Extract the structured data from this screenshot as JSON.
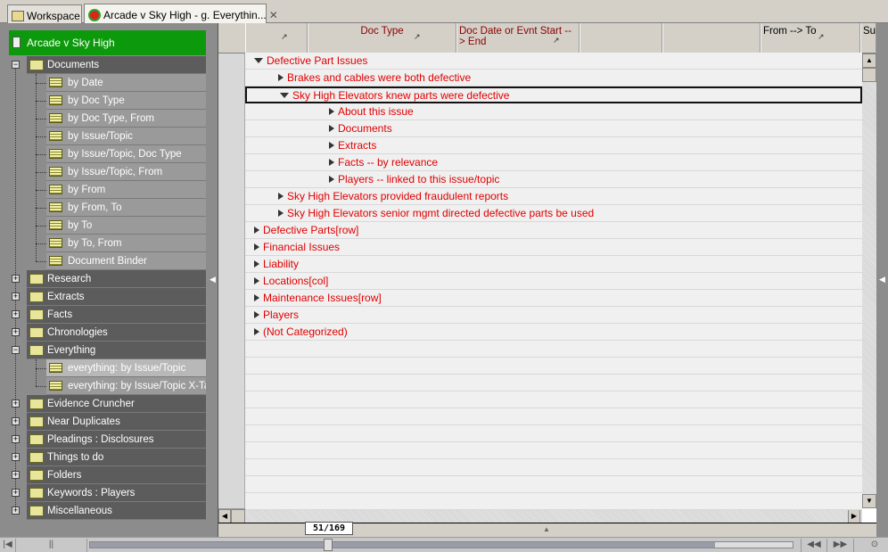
{
  "tabs": [
    {
      "label": "Workspace",
      "icon": "workspace-folder-icon"
    },
    {
      "label": "Arcade v Sky High - g. Everythin...",
      "icon": "case-icon",
      "close": "✕"
    }
  ],
  "tree": {
    "root": "Arcade v Sky High",
    "documents": {
      "label": "Documents",
      "children": [
        "by Date",
        "by Doc Type",
        "by Doc Type, From",
        "by Issue/Topic",
        "by Issue/Topic, Doc Type",
        "by Issue/Topic, From",
        "by From",
        "by From, To",
        "by To",
        "by To, From",
        "Document Binder"
      ]
    },
    "collapsed_a": [
      "Research",
      "Extracts",
      "Facts",
      "Chronologies"
    ],
    "everything": {
      "label": "Everything",
      "children": [
        "everything: by Issue/Topic",
        "everything: by Issue/Topic X-Tab"
      ],
      "selected_index": 0
    },
    "collapsed_b": [
      "Evidence Cruncher",
      "Near Duplicates",
      "Pleadings : Disclosures",
      "Things to do",
      "Folders",
      "Keywords : Players",
      "Miscellaneous"
    ]
  },
  "columns": [
    "",
    "Doc Type",
    "Doc Date or Evnt Start --> End",
    "",
    "",
    "From --> To",
    "Sur"
  ],
  "rows": [
    {
      "label": "Defective Part Issues",
      "level": 0,
      "expanded": true
    },
    {
      "label": "Brakes and cables were both defective",
      "level": 1,
      "expanded": false
    },
    {
      "label": "Sky High Elevators knew parts were defective",
      "level": 1,
      "expanded": true,
      "selected": true
    },
    {
      "label": "About this issue",
      "level": 2,
      "expanded": false
    },
    {
      "label": "Documents",
      "level": 2,
      "expanded": false
    },
    {
      "label": "Extracts",
      "level": 2,
      "expanded": false
    },
    {
      "label": "Facts -- by relevance",
      "level": 2,
      "expanded": false
    },
    {
      "label": "Players -- linked to this issue/topic",
      "level": 2,
      "expanded": false
    },
    {
      "label": "Sky High Elevators provided fraudulent reports",
      "level": 1,
      "expanded": false
    },
    {
      "label": "Sky High Elevators senior mgmt directed defective parts be used",
      "level": 1,
      "expanded": false
    },
    {
      "label": "Defective Parts[row]",
      "level": 0,
      "expanded": false
    },
    {
      "label": "Financial Issues",
      "level": 0,
      "expanded": false
    },
    {
      "label": "Liability",
      "level": 0,
      "expanded": false
    },
    {
      "label": "Locations[col]",
      "level": 0,
      "expanded": false
    },
    {
      "label": "Maintenance Issues[row]",
      "level": 0,
      "expanded": false
    },
    {
      "label": "Players",
      "level": 0,
      "expanded": false
    },
    {
      "label": "(Not Categorized)",
      "level": 0,
      "expanded": false
    }
  ],
  "pager": "51/169",
  "progress_fraction": 0.89,
  "colors": {
    "root": "#0c9a0c",
    "row_text": "#e00000",
    "header_text": "#8b0000"
  }
}
